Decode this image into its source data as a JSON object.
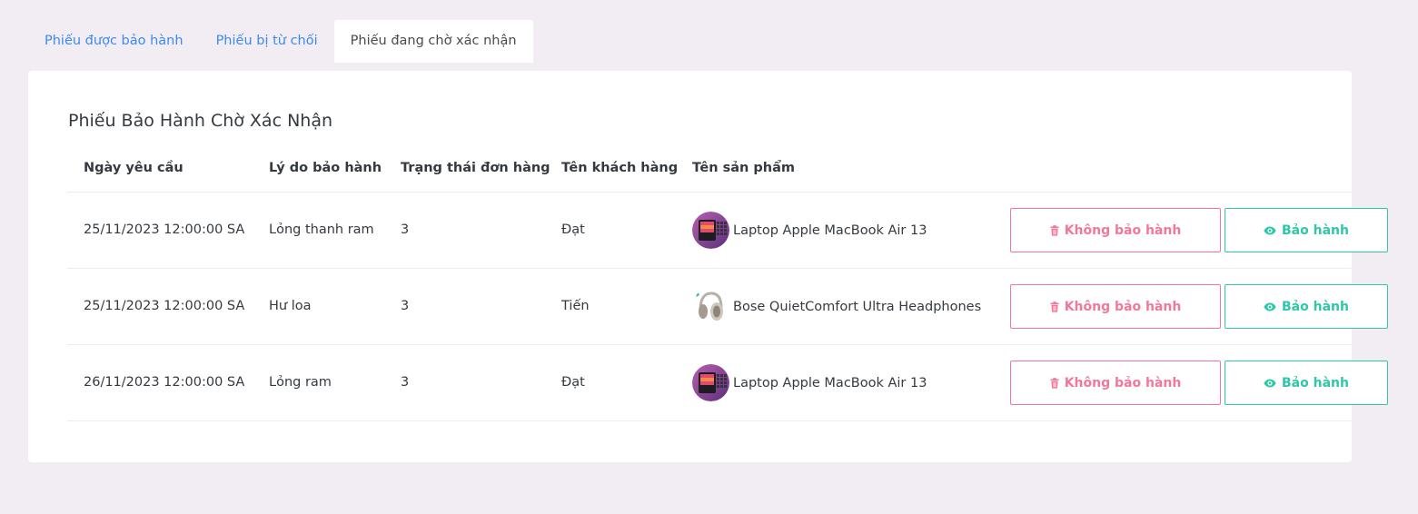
{
  "tabs": [
    {
      "label": "Phiếu được bảo hành",
      "active": false
    },
    {
      "label": "Phiếu bị từ chối",
      "active": false
    },
    {
      "label": "Phiếu đang chờ xác nhận",
      "active": true
    }
  ],
  "card": {
    "title": "Phiếu Bảo Hành Chờ Xác Nhận"
  },
  "table": {
    "headers": [
      "Ngày yêu cầu",
      "Lý do bảo hành",
      "Trạng thái đơn hàng",
      "Tên khách hàng",
      "Tên sản phẩm"
    ],
    "rows": [
      {
        "date": "25/11/2023 12:00:00 SA",
        "reason": "Lỏng thanh ram",
        "status": "3",
        "customer": "Đạt",
        "product": "Laptop Apple MacBook Air 13",
        "product_icon": "laptop-thumbnail"
      },
      {
        "date": "25/11/2023 12:00:00 SA",
        "reason": "Hư loa",
        "status": "3",
        "customer": "Tiến",
        "product": "Bose QuietComfort Ultra Headphones",
        "product_icon": "headphones-thumbnail"
      },
      {
        "date": "26/11/2023 12:00:00 SA",
        "reason": "Lỏng ram",
        "status": "3",
        "customer": "Đạt",
        "product": "Laptop Apple MacBook Air 13",
        "product_icon": "laptop-thumbnail"
      }
    ]
  },
  "actions": {
    "reject_label": "Không bảo hành",
    "reject_icon": "trash-icon",
    "accept_label": "Bảo hành",
    "accept_icon": "eye-icon"
  },
  "colors": {
    "page_bg": "#f2edf3",
    "tab_link": "#3b8af2",
    "reject": "#f2789a",
    "accept": "#2fc7a8"
  }
}
